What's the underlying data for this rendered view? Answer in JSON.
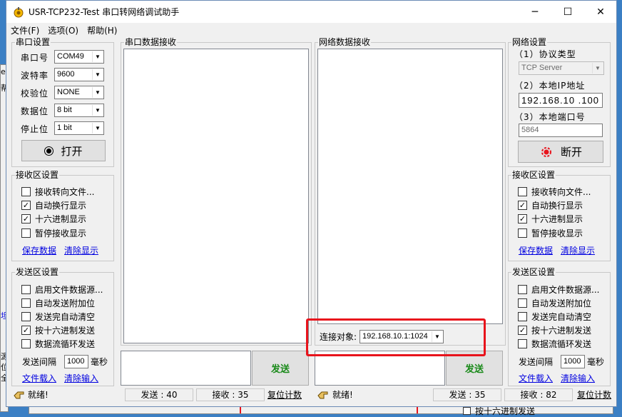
{
  "window": {
    "title": "USR-TCP232-Test 串口转网络调试助手"
  },
  "menu": [
    "文件(F)",
    "选项(O)",
    "帮助(H)"
  ],
  "serial_settings": {
    "title": "串口设置",
    "port_label": "串口号",
    "port_value": "COM49",
    "baud_label": "波特率",
    "baud_value": "9600",
    "parity_label": "校验位",
    "parity_value": "NONE",
    "data_label": "数据位",
    "data_value": "8 bit",
    "stop_label": "停止位",
    "stop_value": "1 bit",
    "open_button": "打开"
  },
  "left_receive": {
    "title": "接收区设置",
    "options": [
      {
        "label": "接收转向文件...",
        "checked": false
      },
      {
        "label": "自动换行显示",
        "checked": true
      },
      {
        "label": "十六进制显示",
        "checked": true
      },
      {
        "label": "暂停接收显示",
        "checked": false
      }
    ],
    "save_link": "保存数据",
    "clear_link": "清除显示"
  },
  "left_send": {
    "title": "发送区设置",
    "options": [
      {
        "label": "启用文件数据源...",
        "checked": false
      },
      {
        "label": "自动发送附加位",
        "checked": false
      },
      {
        "label": "发送完自动清空",
        "checked": false
      },
      {
        "label": "按十六进制发送",
        "checked": true
      },
      {
        "label": "数据流循环发送",
        "checked": false
      }
    ],
    "interval_label": "发送间隔",
    "interval_value": "1000",
    "interval_unit": "毫秒",
    "load_link": "文件载入",
    "clear_link": "清除输入"
  },
  "serial_receive_title": "串口数据接收",
  "network_receive_title": "网络数据接收",
  "send_label": "发送",
  "connect": {
    "label": "连接对象:",
    "value": "192.168.10.1:1024"
  },
  "network_settings": {
    "title": "网络设置",
    "protocol_label": "（1）协议类型",
    "protocol_value": "TCP Server",
    "ip_label": "（2）本地IP地址",
    "ip_value": "192.168.10 .100",
    "port_label": "（3）本地端口号",
    "port_value": "5864",
    "disconnect_button": "断开"
  },
  "right_receive": {
    "title": "接收区设置",
    "options": [
      {
        "label": "接收转向文件...",
        "checked": false
      },
      {
        "label": "自动换行显示",
        "checked": true
      },
      {
        "label": "十六进制显示",
        "checked": true
      },
      {
        "label": "暂停接收显示",
        "checked": false
      }
    ],
    "save_link": "保存数据",
    "clear_link": "清除显示"
  },
  "right_send": {
    "title": "发送区设置",
    "options": [
      {
        "label": "启用文件数据源...",
        "checked": false
      },
      {
        "label": "自动发送附加位",
        "checked": false
      },
      {
        "label": "发送完自动清空",
        "checked": false
      },
      {
        "label": "按十六进制发送",
        "checked": true
      },
      {
        "label": "数据流循环发送",
        "checked": false
      }
    ],
    "interval_label": "发送间隔",
    "interval_value": "1000",
    "interval_unit": "毫秒",
    "load_link": "文件载入",
    "clear_link": "清除输入"
  },
  "status_left": {
    "ready": "就绪!",
    "sent": "发送 : 40",
    "received": "接收 : 35",
    "reset": "复位计数"
  },
  "status_right": {
    "ready": "就绪!",
    "sent": "发送 : 35",
    "received": "接收 : 82",
    "reset": "复位计数"
  },
  "background": {
    "edge_chars": [
      "e",
      "帮",
      "坦",
      "源",
      "位",
      "全"
    ],
    "bottom_text": "按十六进制发送"
  },
  "colors": {
    "highlight": "#e8131c",
    "send_text": "#1a8a1a",
    "link": "#0000e0"
  }
}
